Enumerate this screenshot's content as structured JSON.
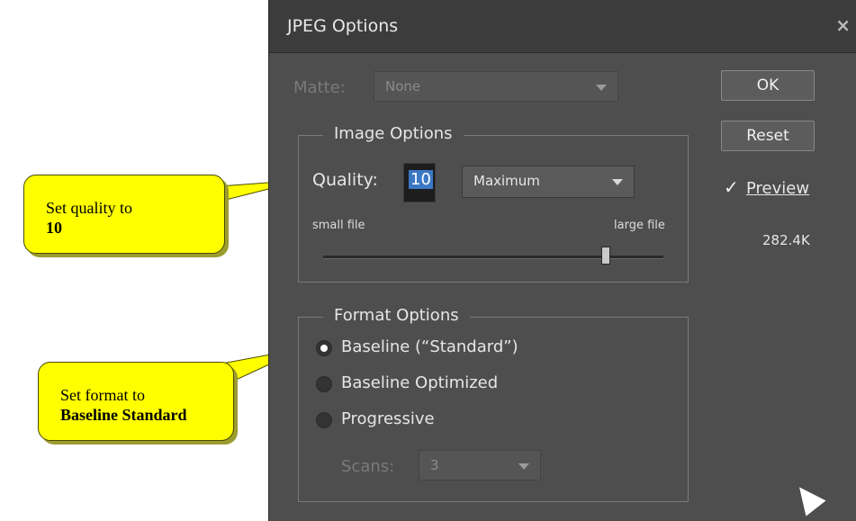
{
  "dialog": {
    "title": "JPEG Options",
    "close_glyph": "×",
    "matte": {
      "label": "Matte:",
      "value": "None"
    },
    "buttons": {
      "ok": "OK",
      "reset": "Reset"
    },
    "image_options": {
      "legend": "Image Options",
      "quality_label": "Quality:",
      "quality_value": "10",
      "quality_preset": "Maximum",
      "slider_min_label": "small file",
      "slider_max_label": "large file",
      "slider_position_pct": 83
    },
    "preview": {
      "label": "Preview",
      "checked": true,
      "file_size": "282.4K"
    },
    "format_options": {
      "legend": "Format Options",
      "options": [
        {
          "label": "Baseline (“Standard”)",
          "selected": true
        },
        {
          "label": "Baseline Optimized",
          "selected": false
        },
        {
          "label": "Progressive",
          "selected": false
        }
      ],
      "scans": {
        "label": "Scans:",
        "value": "3"
      }
    }
  },
  "callouts": [
    {
      "line1": "Set quality to",
      "line2": "10"
    },
    {
      "line1": "Set format to",
      "line2": "Baseline Standard"
    }
  ],
  "colors": {
    "dialog_bg": "#4e4e4e",
    "callout_bg": "#ffff00",
    "selection_highlight": "#3b78c4"
  },
  "icons": [
    "close-icon",
    "dropdown-arrow-icon",
    "checkbox-icon",
    "radio-icon",
    "mouse-cursor-icon"
  ]
}
